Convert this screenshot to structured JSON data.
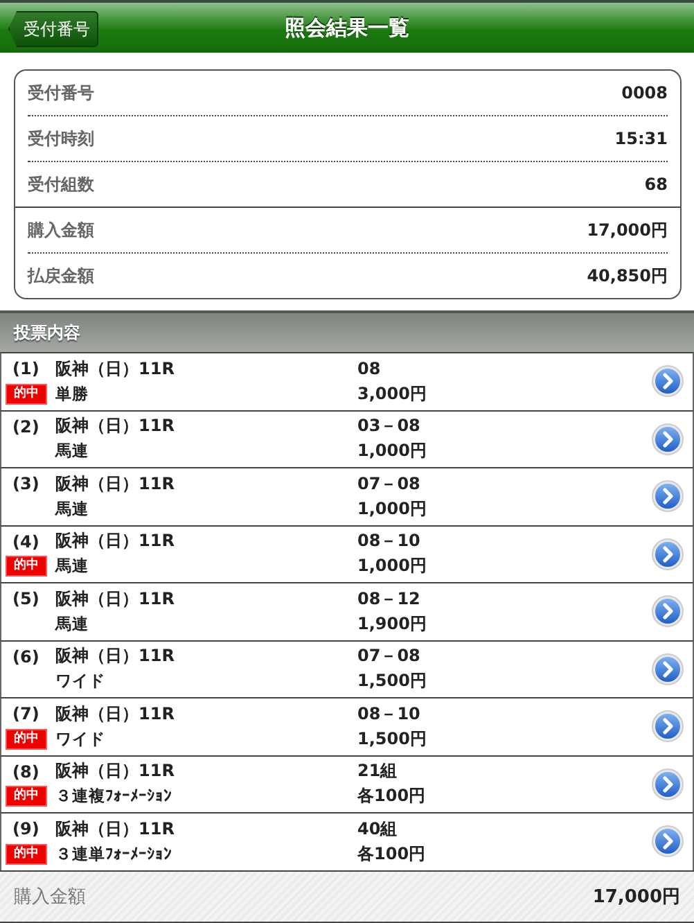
{
  "header": {
    "back_button": "受付番号",
    "title": "照会結果一覧"
  },
  "summary": {
    "groups": [
      [
        {
          "label": "受付番号",
          "value": "0008"
        },
        {
          "label": "受付時刻",
          "value": "15:31"
        },
        {
          "label": "受付組数",
          "value": "68"
        }
      ],
      [
        {
          "label": "購入金額",
          "value": "17,000円"
        },
        {
          "label": "払戻金額",
          "value": "40,850円"
        }
      ]
    ]
  },
  "bets": {
    "heading": "投票内容",
    "items": [
      {
        "number": "(1)",
        "race": "阪神（日）11R",
        "type": "単勝",
        "selection": "08",
        "amount": "3,000円",
        "hit": true,
        "hit_label": "的中"
      },
      {
        "number": "(2)",
        "race": "阪神（日）11R",
        "type": "馬連",
        "selection": "03－08",
        "amount": "1,000円",
        "hit": false
      },
      {
        "number": "(3)",
        "race": "阪神（日）11R",
        "type": "馬連",
        "selection": "07－08",
        "amount": "1,000円",
        "hit": false
      },
      {
        "number": "(4)",
        "race": "阪神（日）11R",
        "type": "馬連",
        "selection": "08－10",
        "amount": "1,000円",
        "hit": true,
        "hit_label": "的中"
      },
      {
        "number": "(5)",
        "race": "阪神（日）11R",
        "type": "馬連",
        "selection": "08－12",
        "amount": "1,900円",
        "hit": false
      },
      {
        "number": "(6)",
        "race": "阪神（日）11R",
        "type": "ワイド",
        "selection": "07－08",
        "amount": "1,500円",
        "hit": false
      },
      {
        "number": "(7)",
        "race": "阪神（日）11R",
        "type": "ワイド",
        "selection": "08－10",
        "amount": "1,500円",
        "hit": true,
        "hit_label": "的中"
      },
      {
        "number": "(8)",
        "race": "阪神（日）11R",
        "type": "３連複ﾌｫｰﾒｰｼｮﾝ",
        "selection": "21組",
        "amount": "各100円",
        "hit": true,
        "hit_label": "的中"
      },
      {
        "number": "(9)",
        "race": "阪神（日）11R",
        "type": "３連単ﾌｫｰﾒｰｼｮﾝ",
        "selection": "40組",
        "amount": "各100円",
        "hit": true,
        "hit_label": "的中"
      }
    ]
  },
  "footer": {
    "label": "購入金額",
    "value": "17,000円"
  }
}
